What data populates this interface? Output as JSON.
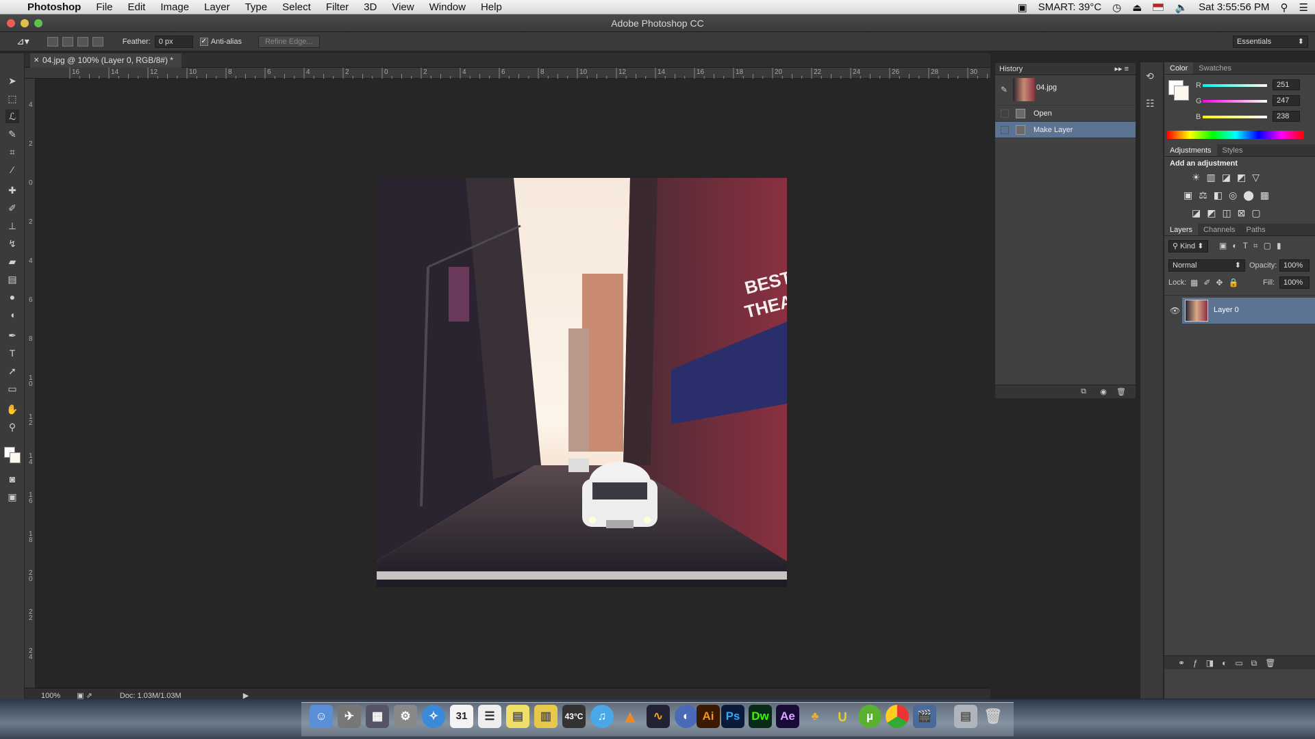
{
  "menubar": {
    "app_name": "Photoshop",
    "items": [
      "File",
      "Edit",
      "Image",
      "Layer",
      "Type",
      "Select",
      "Filter",
      "3D",
      "View",
      "Window",
      "Help"
    ],
    "status": "SMART: 39°C",
    "clock": "Sat 3:55:56 PM"
  },
  "window": {
    "title": "Adobe Photoshop CC"
  },
  "options": {
    "feather_label": "Feather:",
    "feather_value": "0 px",
    "antialias_label": "Anti-alias",
    "antialias_checked": true,
    "refine_edge_label": "Refine Edge...",
    "workspace": "Essentials"
  },
  "document": {
    "tab_title": "04.jpg @ 100% (Layer 0, RGB/8#) *",
    "zoom": "100%",
    "doc_info": "Doc: 1.03M/1.03M"
  },
  "rulers": {
    "h_ticks": [
      "16",
      "14",
      "12",
      "10",
      "8",
      "6",
      "4",
      "2",
      "0",
      "2",
      "4",
      "6",
      "8",
      "10",
      "12",
      "14",
      "16",
      "18",
      "20",
      "22",
      "24",
      "26",
      "28",
      "30"
    ],
    "v_ticks": [
      "4",
      "2",
      "0",
      "2",
      "4",
      "6",
      "8",
      "1 0",
      "1 2",
      "1 4",
      "1 6",
      "1 8",
      "2 0",
      "2 2",
      "2 4"
    ]
  },
  "history": {
    "title": "History",
    "snapshot": "04.jpg",
    "items": [
      {
        "label": "Open",
        "selected": false
      },
      {
        "label": "Make Layer",
        "selected": true
      }
    ]
  },
  "color_panel": {
    "tabs": [
      "Color",
      "Swatches"
    ],
    "r_label": "R",
    "g_label": "G",
    "b_label": "B",
    "r": "251",
    "g": "247",
    "b": "238"
  },
  "adjustments": {
    "tabs": [
      "Adjustments",
      "Styles"
    ],
    "heading": "Add an adjustment"
  },
  "layers": {
    "tabs": [
      "Layers",
      "Channels",
      "Paths"
    ],
    "kind_label": "Kind",
    "blend_mode": "Normal",
    "opacity_label": "Opacity:",
    "opacity_value": "100%",
    "lock_label": "Lock:",
    "fill_label": "Fill:",
    "fill_value": "100%",
    "layer_name": "Layer 0"
  },
  "dock": {
    "ai_label": "Ai",
    "ps_label": "Ps",
    "dw_label": "Dw",
    "ae_label": "Ae",
    "calendar_day": "31",
    "temp": "43°C"
  }
}
